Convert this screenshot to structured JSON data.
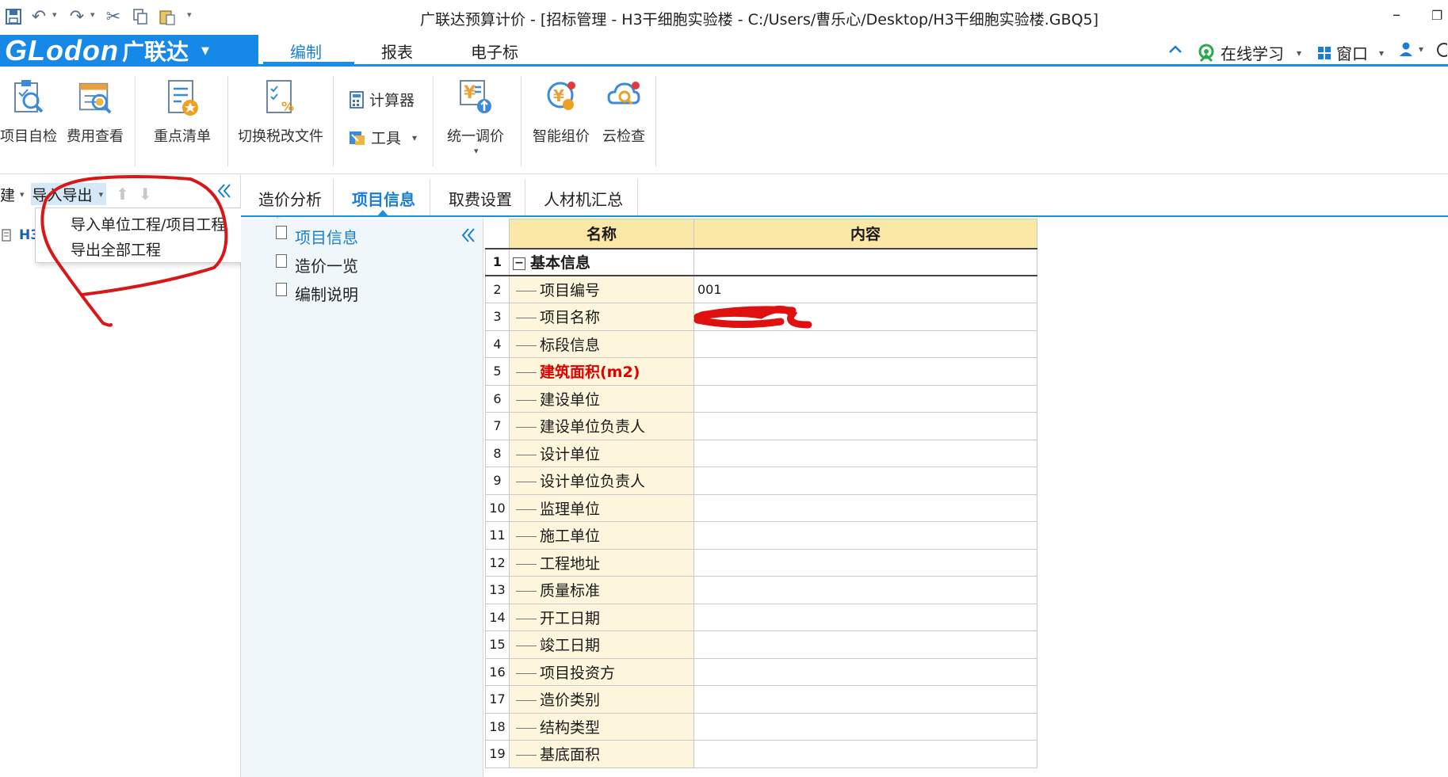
{
  "window": {
    "title": "广联达预算计价 - [招标管理 - H3干细胞实验楼 - C:/Users/曹乐心/Desktop/H3干细胞实验楼.GBQ5]"
  },
  "logo": {
    "text": "GLodon",
    "cn": "广联达"
  },
  "ribbon_tabs": [
    {
      "label": "编制",
      "active": true
    },
    {
      "label": "报表",
      "active": false
    },
    {
      "label": "电子标",
      "active": false
    }
  ],
  "right_tools": {
    "online_learning": "在线学习",
    "window": "窗口"
  },
  "ribbon_buttons": {
    "self_check": "项目自检",
    "fee_view": "费用查看",
    "key_list": "重点清单",
    "switch_tax": "切换税改文件",
    "calculator": "计算器",
    "tools": "工具",
    "unified_price": "统一调价",
    "smart_price": "智能组价",
    "cloud_check": "云检查"
  },
  "left_toolbar": {
    "new": "建",
    "import_export": "导入导出"
  },
  "tree_root": "H3",
  "dropdown": {
    "items": [
      "导入单位工程/项目工程",
      "导出全部工程"
    ]
  },
  "content_tabs": [
    {
      "label": "造价分析",
      "active": false
    },
    {
      "label": "项目信息",
      "active": true
    },
    {
      "label": "取费设置",
      "active": false
    },
    {
      "label": "人材机汇总",
      "active": false
    }
  ],
  "nav_items": [
    {
      "label": "项目信息",
      "active": true
    },
    {
      "label": "造价一览",
      "active": false
    },
    {
      "label": "编制说明",
      "active": false
    }
  ],
  "grid": {
    "headers": {
      "name": "名称",
      "content": "内容"
    },
    "rows": [
      {
        "num": "1",
        "name": "基本信息",
        "content": "",
        "group": true
      },
      {
        "num": "2",
        "name": "项目编号",
        "content": "001"
      },
      {
        "num": "3",
        "name": "项目名称",
        "content": ""
      },
      {
        "num": "4",
        "name": "标段信息",
        "content": ""
      },
      {
        "num": "5",
        "name": "建筑面积(m2)",
        "content": "",
        "required": true
      },
      {
        "num": "6",
        "name": "建设单位",
        "content": ""
      },
      {
        "num": "7",
        "name": "建设单位负责人",
        "content": ""
      },
      {
        "num": "8",
        "name": "设计单位",
        "content": ""
      },
      {
        "num": "9",
        "name": "设计单位负责人",
        "content": ""
      },
      {
        "num": "10",
        "name": "监理单位",
        "content": ""
      },
      {
        "num": "11",
        "name": "施工单位",
        "content": ""
      },
      {
        "num": "12",
        "name": "工程地址",
        "content": ""
      },
      {
        "num": "13",
        "name": "质量标准",
        "content": ""
      },
      {
        "num": "14",
        "name": "开工日期",
        "content": ""
      },
      {
        "num": "15",
        "name": "竣工日期",
        "content": ""
      },
      {
        "num": "16",
        "name": "项目投资方",
        "content": ""
      },
      {
        "num": "17",
        "name": "造价类别",
        "content": ""
      },
      {
        "num": "18",
        "name": "结构类型",
        "content": ""
      },
      {
        "num": "19",
        "name": "基底面积",
        "content": ""
      }
    ]
  },
  "colors": {
    "accent": "#1a8fe0",
    "header_fill": "#fbe7a6",
    "name_fill": "#fdf6dd",
    "nav_fill": "#f0f7fb",
    "annotation_red": "#d81818"
  }
}
